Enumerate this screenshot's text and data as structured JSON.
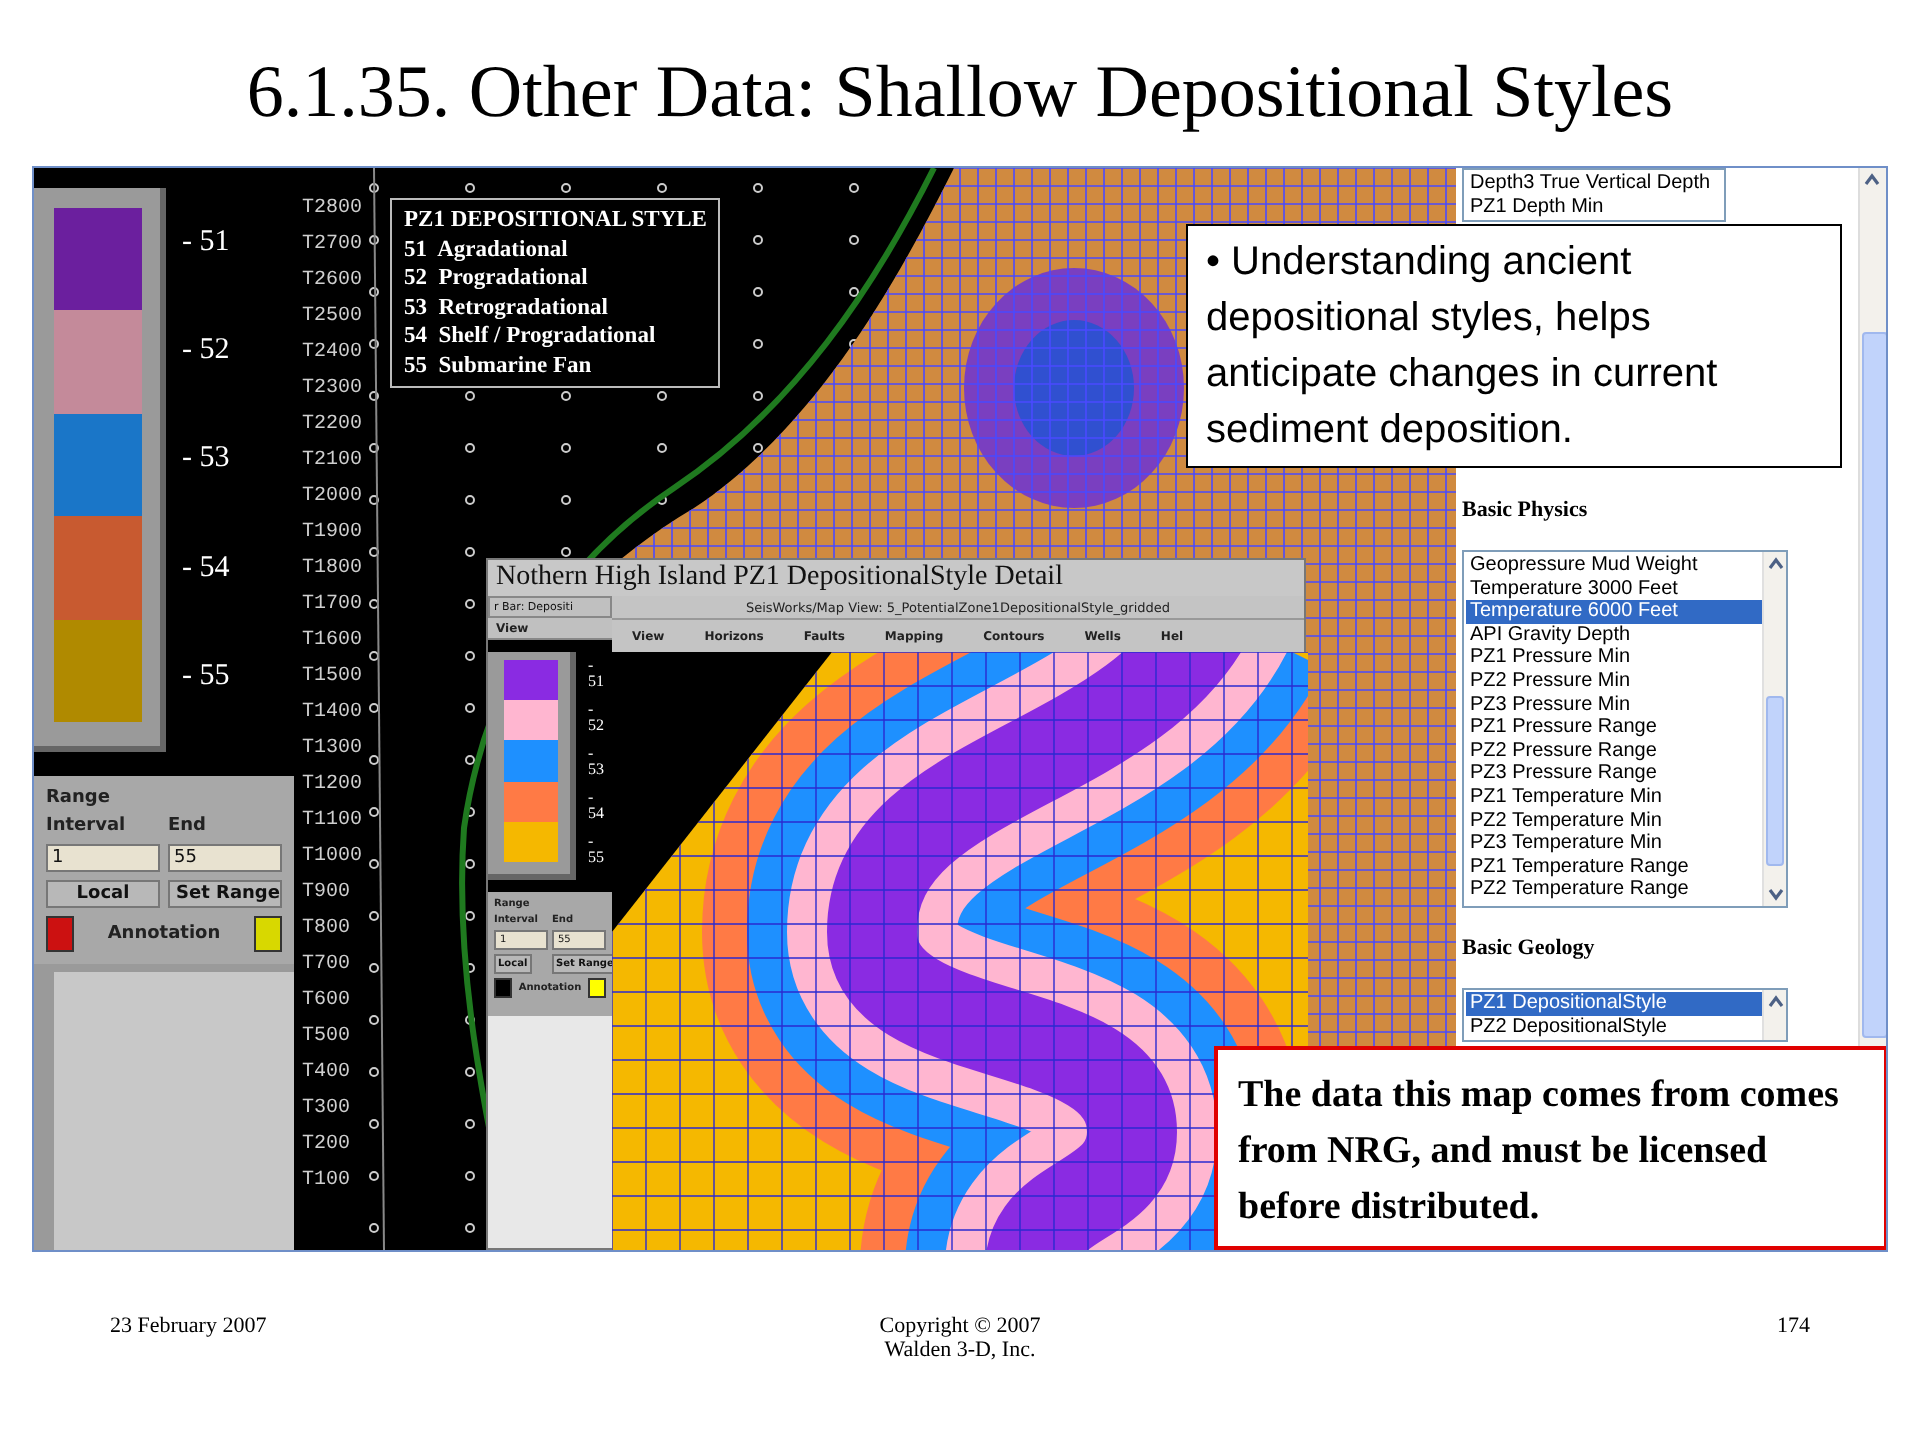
{
  "title": "6.1.35. Other Data: Shallow Depositional Styles",
  "color_bar": {
    "segments": [
      {
        "color": "#6b1f9e",
        "label": "- 51"
      },
      {
        "color": "#c48a9a",
        "label": "- 52"
      },
      {
        "color": "#1a76c8",
        "label": "- 53"
      },
      {
        "color": "#c85a30",
        "label": "- 54"
      },
      {
        "color": "#b08a00",
        "label": "- 55"
      }
    ],
    "range": {
      "heading": "Range",
      "interval_label": "Interval",
      "end_label": "End",
      "interval": "1",
      "end": "55",
      "scope": "Local",
      "set_button": "Set Range",
      "annotation_label": "Annotation"
    }
  },
  "map": {
    "contour_labels": [
      "T2800",
      "T2700",
      "T2600",
      "T2500",
      "T2400",
      "T2300",
      "T2200",
      "T2100",
      "T2000",
      "T1900",
      "T1800",
      "T1700",
      "T1600",
      "T1500",
      "T1400",
      "T1300",
      "T1200",
      "T1100",
      "T1000",
      "T900",
      "T800",
      "T700",
      "T600",
      "T500",
      "T400",
      "T300",
      "T200",
      "T100"
    ]
  },
  "legend": {
    "title": "PZ1 DEPOSITIONAL STYLE",
    "items": [
      "51  Agradational",
      "52  Progradational",
      "53  Retrogradational",
      "54  Shelf / Progradational",
      "55  Submarine Fan"
    ]
  },
  "detail_window": {
    "title": "Nothern High Island PZ1 DepositionalStyle Detail",
    "selector": "r Bar: Depositi",
    "view_menu": "View",
    "color_bar": {
      "segments": [
        {
          "color": "#8a2be2",
          "label": "- 51"
        },
        {
          "color": "#ffb6d0",
          "label": "- 52"
        },
        {
          "color": "#1e90ff",
          "label": "- 53"
        },
        {
          "color": "#ff7a45",
          "label": "- 54"
        },
        {
          "color": "#f5b800",
          "label": "- 55"
        }
      ],
      "range": {
        "heading": "Range",
        "interval_label": "Interval",
        "end_label": "End",
        "interval": "1",
        "end": "55",
        "scope": "Local",
        "set_button": "Set Range",
        "annotation_label": "Annotation"
      }
    },
    "map_title": "SeisWorks/Map View: 5_PotentialZone1DepositionalStyle_gridded",
    "menu": [
      "View",
      "Horizons",
      "Faults",
      "Mapping",
      "Contours",
      "Wells",
      "Hel"
    ]
  },
  "side_panel": {
    "top_list": [
      {
        "label": "Depth3 True Vertical Depth",
        "selected": false
      },
      {
        "label": "PZ1 Depth Min",
        "selected": false
      }
    ],
    "sections": [
      {
        "heading": "Basic Physics",
        "items": [
          {
            "label": "Geopressure Mud Weight",
            "selected": false
          },
          {
            "label": "Temperature 3000 Feet",
            "selected": false
          },
          {
            "label": "Temperature 6000 Feet",
            "selected": true
          },
          {
            "label": "API Gravity Depth",
            "selected": false
          },
          {
            "label": "PZ1 Pressure Min",
            "selected": false
          },
          {
            "label": "PZ2 Pressure Min",
            "selected": false
          },
          {
            "label": "PZ3 Pressure Min",
            "selected": false
          },
          {
            "label": "PZ1 Pressure Range",
            "selected": false
          },
          {
            "label": "PZ2 Pressure Range",
            "selected": false
          },
          {
            "label": "PZ3 Pressure Range",
            "selected": false
          },
          {
            "label": "PZ1 Temperature Min",
            "selected": false
          },
          {
            "label": "PZ2 Temperature Min",
            "selected": false
          },
          {
            "label": "PZ3 Temperature Min",
            "selected": false
          },
          {
            "label": "PZ1 Temperature Range",
            "selected": false
          },
          {
            "label": "PZ2 Temperature Range",
            "selected": false
          }
        ]
      },
      {
        "heading": "Basic Geology",
        "items": [
          {
            "label": "PZ1 DepositionalStyle",
            "selected": true
          },
          {
            "label": "PZ2 DepositionalStyle",
            "selected": false
          }
        ]
      }
    ]
  },
  "callout": "• Understanding ancient depositional styles, helps anticipate changes in current sediment deposition.",
  "note": "The data this map comes from comes from NRG, and must be licensed before distributed.",
  "footer": {
    "date": "23 February 2007",
    "copyright": [
      "Copyright © 2007",
      "Walden 3-D, Inc."
    ],
    "page": "174"
  }
}
